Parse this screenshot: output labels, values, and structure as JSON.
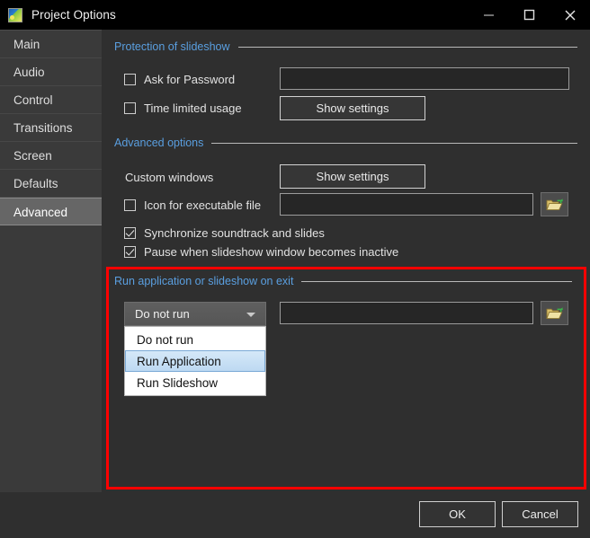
{
  "window": {
    "title": "Project Options",
    "icon": "app-photo-icon",
    "minimize_label": "—",
    "maximize_label": "□",
    "close_label": "✕"
  },
  "sidebar": {
    "items": [
      {
        "label": "Main",
        "selected": false
      },
      {
        "label": "Audio",
        "selected": false
      },
      {
        "label": "Control",
        "selected": false
      },
      {
        "label": "Transitions",
        "selected": false
      },
      {
        "label": "Screen",
        "selected": false
      },
      {
        "label": "Defaults",
        "selected": false
      },
      {
        "label": "Advanced",
        "selected": true
      }
    ]
  },
  "sections": {
    "protection": {
      "title": "Protection of slideshow",
      "ask_for_password": {
        "label": "Ask for Password",
        "checked": false
      },
      "password_value": "",
      "time_limited_usage": {
        "label": "Time limited usage",
        "checked": false
      },
      "time_settings_button": "Show settings"
    },
    "advanced": {
      "title": "Advanced options",
      "custom_windows_label": "Custom windows",
      "custom_windows_button": "Show settings",
      "icon_for_exe": {
        "label": "Icon for executable file",
        "checked": false
      },
      "icon_path_value": "",
      "icon_browse": "folder-open-icon",
      "synchronize": {
        "label": "Synchronize soundtrack and slides",
        "checked": true
      },
      "pause_inactive": {
        "label": "Pause when slideshow window becomes inactive",
        "checked": true
      }
    },
    "run_on_exit": {
      "title": "Run application or slideshow on exit",
      "dropdown_selected": "Do not run",
      "dropdown_open": true,
      "dropdown_options": [
        {
          "label": "Do not run",
          "highlighted": false
        },
        {
          "label": "Run Application",
          "highlighted": true
        },
        {
          "label": "Run Slideshow",
          "highlighted": false
        }
      ],
      "path_value": "",
      "path_browse": "folder-open-icon"
    }
  },
  "footer": {
    "ok_label": "OK",
    "cancel_label": "Cancel"
  },
  "colors": {
    "accent_header": "#5a9fe0",
    "highlight_box": "#ff0000",
    "window_bg": "#2f2f2f",
    "sidebar_bg": "#3a3a3a",
    "selected_item": "#666666"
  }
}
